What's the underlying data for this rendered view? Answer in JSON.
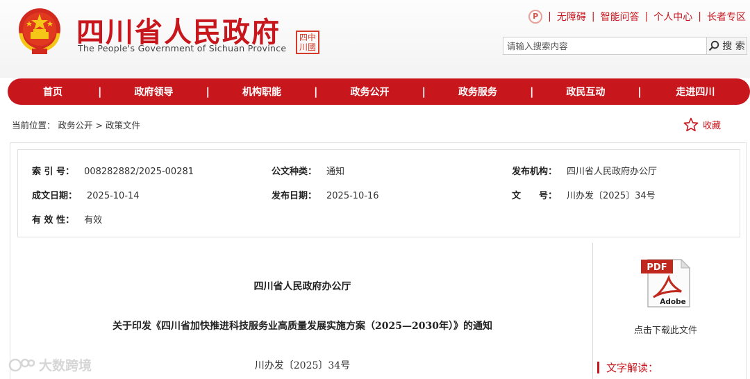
{
  "header": {
    "title": "四川省人民政府",
    "subtitle": "The People's Government of Sichuan Province",
    "seal_text": "中國四川",
    "top_links": [
      "无障碍",
      "智能问答",
      "个人中心",
      "长者专区"
    ],
    "search_placeholder": "请输入搜索内容",
    "search_button": "搜 索"
  },
  "nav": {
    "items": [
      "首页",
      "政府领导",
      "机构职能",
      "政务公开",
      "政务服务",
      "政民互动",
      "走进四川"
    ]
  },
  "breadcrumb": {
    "prefix": "当前位置：",
    "level1": "政务公开",
    "separator": ">",
    "level2": "政策文件"
  },
  "favorite_label": "收藏",
  "info": {
    "index_label": "索 引 号：",
    "index_value": "008282882/2025-00281",
    "category_label": "公文种类：",
    "category_value": "通知",
    "publisher_label": "发布机构：",
    "publisher_value": "四川省人民政府办公厅",
    "written_label": "成文日期：",
    "written_value": "2025-10-14",
    "published_label": "发布日期：",
    "published_value": "2025-10-16",
    "docno_label": "文　　号：",
    "docno_value": "川办发〔2025〕34号",
    "validity_label": "有 效 性：",
    "validity_value": "有效"
  },
  "document": {
    "issuer": "四川省人民政府办公厅",
    "title": "关于印发《四川省加快推进科技服务业高质量发展实施方案（2025—2030年）》的通知",
    "number": "川办发〔2025〕34号"
  },
  "sidebar": {
    "download_label": "点击下载此文件",
    "interpretation_label": "文字解读："
  },
  "watermark_text": "大数跨境",
  "colors": {
    "brand_red": "#c8161d"
  }
}
